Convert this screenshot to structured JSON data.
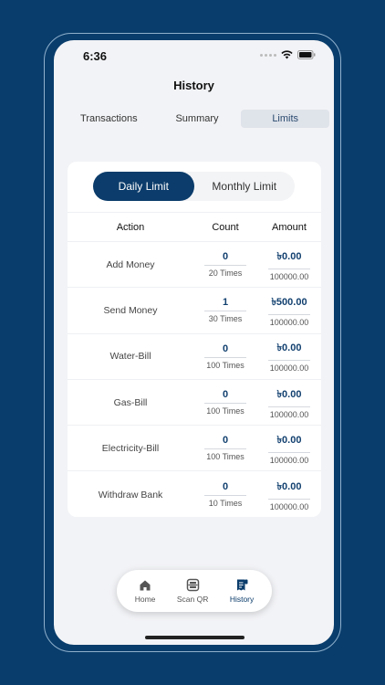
{
  "status_bar": {
    "time": "6:36"
  },
  "header": {
    "title": "History"
  },
  "tabs": [
    {
      "label": "Transactions",
      "active": false
    },
    {
      "label": "Summary",
      "active": false
    },
    {
      "label": "Limits",
      "active": true
    }
  ],
  "limit_toggle": [
    {
      "label": "Daily Limit",
      "active": true
    },
    {
      "label": "Monthly Limit",
      "active": false
    }
  ],
  "table": {
    "headers": [
      "Action",
      "Count",
      "Amount"
    ],
    "rows": [
      {
        "action": "Add Money",
        "count": "0",
        "count_limit": "20 Times",
        "amount": "৳0.00",
        "amount_limit": "100000.00"
      },
      {
        "action": "Send Money",
        "count": "1",
        "count_limit": "30 Times",
        "amount": "৳500.00",
        "amount_limit": "100000.00"
      },
      {
        "action": "Water-Bill",
        "count": "0",
        "count_limit": "100 Times",
        "amount": "৳0.00",
        "amount_limit": "100000.00"
      },
      {
        "action": "Gas-Bill",
        "count": "0",
        "count_limit": "100 Times",
        "amount": "৳0.00",
        "amount_limit": "100000.00"
      },
      {
        "action": "Electricity-Bill",
        "count": "0",
        "count_limit": "100 Times",
        "amount": "৳0.00",
        "amount_limit": "100000.00"
      },
      {
        "action": "Withdraw Bank",
        "count": "0",
        "count_limit": "10 Times",
        "amount": "৳0.00",
        "amount_limit": "100000.00"
      }
    ]
  },
  "nav": [
    {
      "label": "Home",
      "icon": "home-icon",
      "active": false
    },
    {
      "label": "Scan QR",
      "icon": "scan-qr-icon",
      "active": false
    },
    {
      "label": "History",
      "icon": "history-icon",
      "active": true
    }
  ],
  "colors": {
    "background": "#093d6c",
    "accent": "#0b3c6b",
    "screen": "#f2f3f6"
  }
}
